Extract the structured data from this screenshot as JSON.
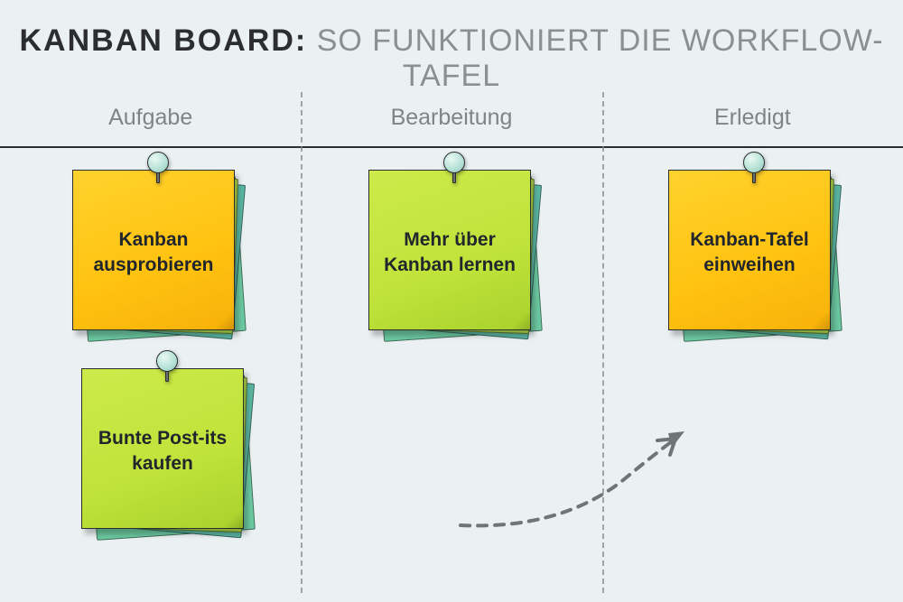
{
  "title": {
    "bold": "KANBAN BOARD:",
    "rest": " SO FUNKTIONIERT DIE WORKFLOW-TAFEL"
  },
  "columns": {
    "c1": "Aufgabe",
    "c2": "Bearbeitung",
    "c3": "Erledigt"
  },
  "notes": {
    "n1": {
      "text": "Kanban ausprobieren",
      "color": "yellow",
      "column": "c1"
    },
    "n2": {
      "text": "Bunte Post-its kaufen",
      "color": "green",
      "column": "c1"
    },
    "n3": {
      "text": "Mehr über Kanban lernen",
      "color": "green",
      "column": "c2"
    },
    "n4": {
      "text": "Kanban-Tafel einweihen",
      "color": "yellow",
      "column": "c3"
    }
  },
  "flow_arrow": {
    "from": "c2",
    "to": "c3"
  }
}
